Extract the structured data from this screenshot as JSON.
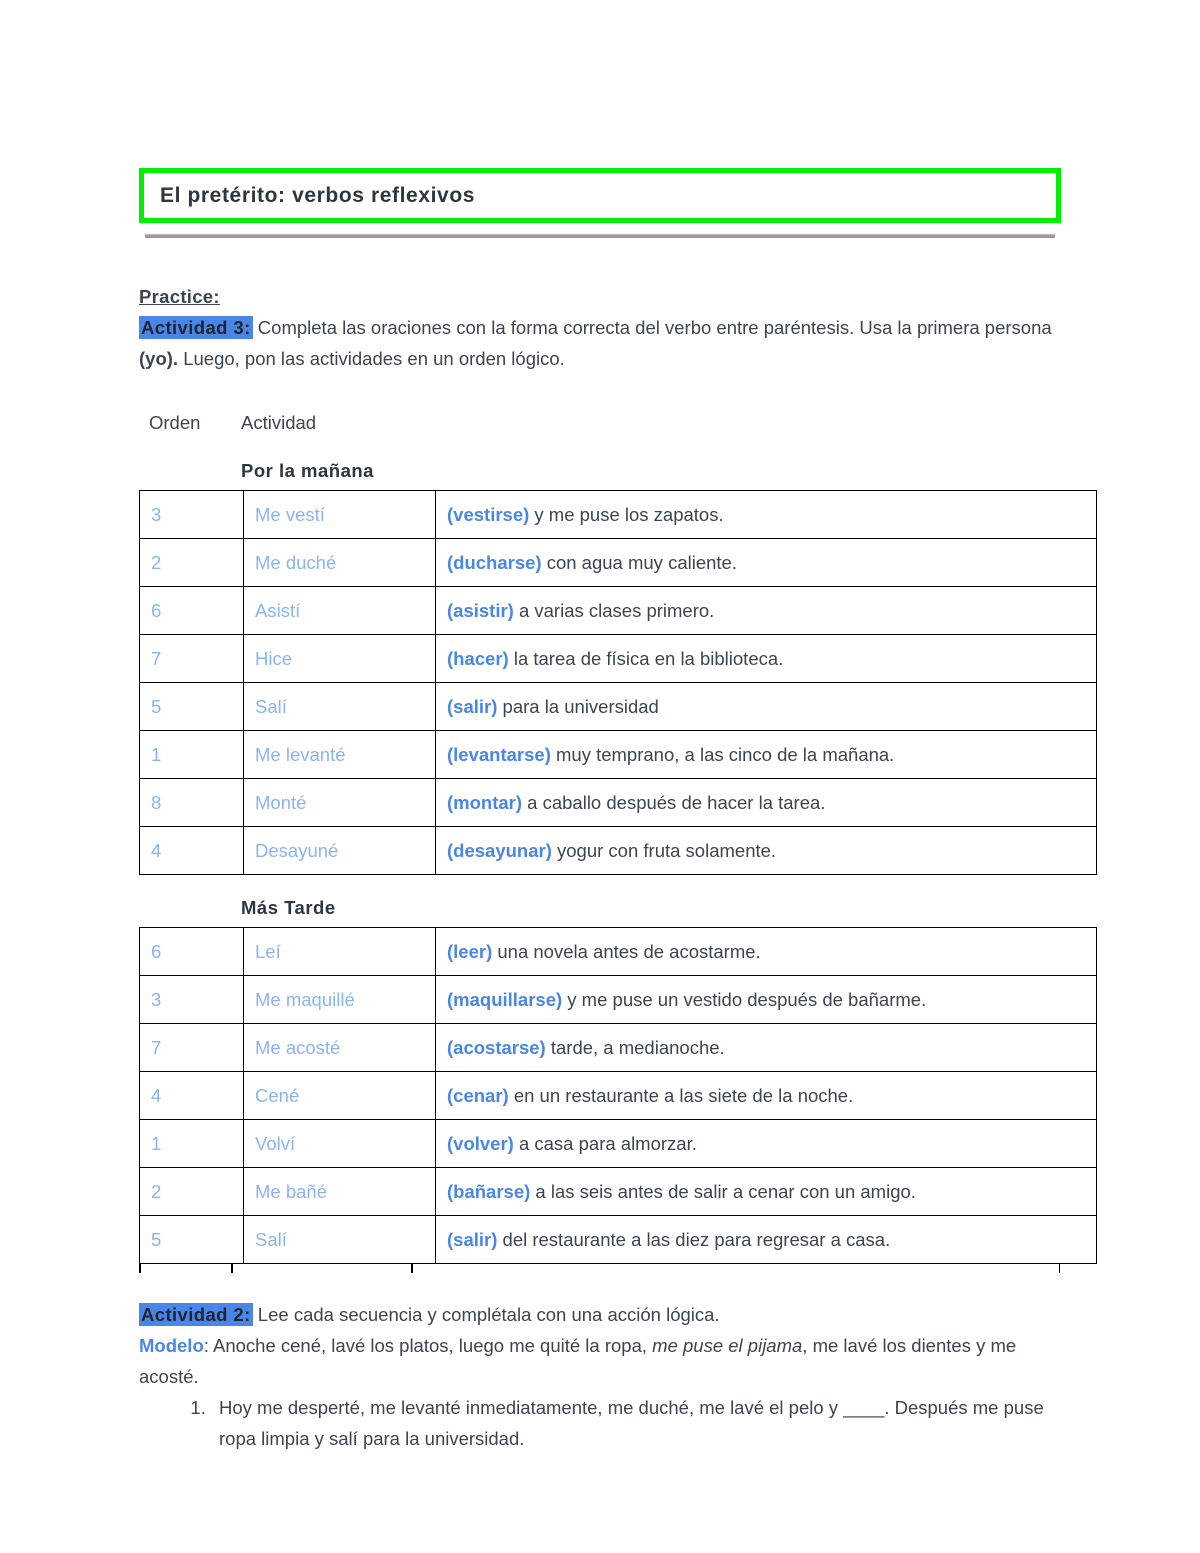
{
  "document": {
    "title": "El pretérito: verbos reflexivos",
    "practice_label": "Practice:"
  },
  "colors": {
    "title_border": "#00ee00",
    "highlight": "#4a86e8",
    "verb_blue": "#4a86e8",
    "light_blue": "#8ab4f0",
    "body_text": "#3d4450",
    "rule_grey": "#9a9a9a"
  },
  "actividad3": {
    "badge": "Actividad 3",
    "colon": ":",
    "instructions_part1": " Completa las oraciones con la forma correcta del verbo entre paréntesis. Usa la primera persona ",
    "instructions_bold": "(yo).",
    "instructions_part2": " Luego, pon las actividades en un orden lógico."
  },
  "table_headers": {
    "orden": "Orden",
    "actividad": "Actividad"
  },
  "sections": [
    {
      "heading": "Por la mañana",
      "rows": [
        {
          "orden": "3",
          "actividad": "Me vestí",
          "verb": "(vestirse)",
          "frase": " y me puse los zapatos."
        },
        {
          "orden": "2",
          "actividad": "Me duché",
          "verb": "(ducharse)",
          "frase": " con agua muy caliente."
        },
        {
          "orden": "6",
          "actividad": "Asistí",
          "verb": "(asistir)",
          "frase": " a varias clases primero."
        },
        {
          "orden": "7",
          "actividad": "Hice",
          "verb": "(hacer)",
          "frase": " la tarea de física en la biblioteca."
        },
        {
          "orden": "5",
          "actividad": "Salí",
          "verb": "(salir)",
          "frase": " para la universidad"
        },
        {
          "orden": "1",
          "actividad": "Me levanté",
          "verb": "(levantarse)",
          "frase": " muy temprano, a las cinco de la mañana."
        },
        {
          "orden": "8",
          "actividad": "Monté",
          "verb": "(montar)",
          "frase": " a caballo después de hacer la tarea."
        },
        {
          "orden": "4",
          "actividad": "Desayuné",
          "verb": "(desayunar)",
          "frase": " yogur con fruta solamente."
        }
      ]
    },
    {
      "heading": "Más Tarde",
      "rows": [
        {
          "orden": "6",
          "actividad": "Leí",
          "verb": "(leer)",
          "frase": " una novela antes de acostarme."
        },
        {
          "orden": "3",
          "actividad": "Me maquillé",
          "verb": "(maquillarse)",
          "frase": " y me puse un vestido después de bañarme."
        },
        {
          "orden": "7",
          "actividad": "Me acosté",
          "verb": "(acostarse)",
          "frase": " tarde, a medianoche."
        },
        {
          "orden": "4",
          "actividad": "Cené",
          "verb": "(cenar)",
          "frase": " en un restaurante a las siete de la noche."
        },
        {
          "orden": "1",
          "actividad": "Volví",
          "verb": "(volver)",
          "frase": " a casa para almorzar."
        },
        {
          "orden": "2",
          "actividad": "Me bañé",
          "verb": "(bañarse)",
          "frase": " a las seis antes de salir a cenar con un amigo."
        },
        {
          "orden": "5",
          "actividad": "Salí",
          "verb": "(salir)",
          "frase": " del restaurante a las diez para regresar a casa."
        }
      ]
    }
  ],
  "actividad2": {
    "badge": "Actividad 2",
    "colon": ":",
    "instructions": " Lee cada secuencia y complétala con una acción lógica.",
    "modelo_label": "Modelo",
    "modelo_part1": ": Anoche cené, lavé los platos, luego me quité la ropa, ",
    "modelo_italic": "me puse el pijama",
    "modelo_part2": ", me lavé los dientes y me acosté.",
    "items": [
      "Hoy me desperté, me levanté inmediatamente, me duché, me lavé el pelo y ____. Después me puse ropa limpia y salí para la universidad."
    ]
  }
}
